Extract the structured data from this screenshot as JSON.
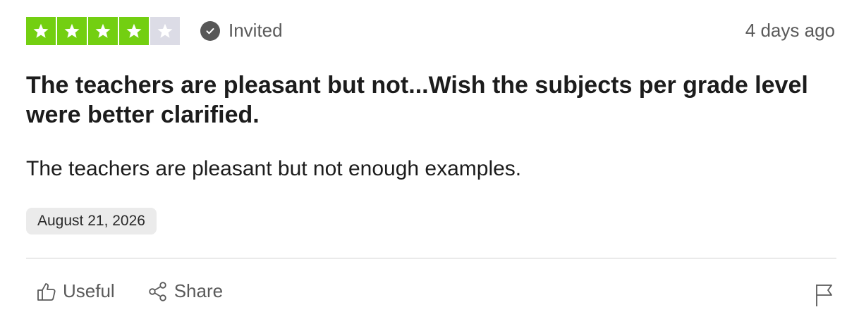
{
  "review": {
    "rating": 4,
    "rating_max": 5,
    "star_color": "#73cf11",
    "empty_star_color": "#dcdce6",
    "badge": {
      "icon": "check-circle-icon",
      "label": "Invited"
    },
    "posted_ago": "4 days ago",
    "title": "The teachers are pleasant but not...Wish the subjects per grade level were better clarified.",
    "text": "The teachers are pleasant but not enough examples.",
    "experience_date": "August 21, 2026"
  },
  "actions": {
    "useful": {
      "icon": "thumbs-up-icon",
      "label": "Useful"
    },
    "share": {
      "icon": "share-icon",
      "label": "Share"
    },
    "report": {
      "icon": "flag-icon"
    }
  }
}
